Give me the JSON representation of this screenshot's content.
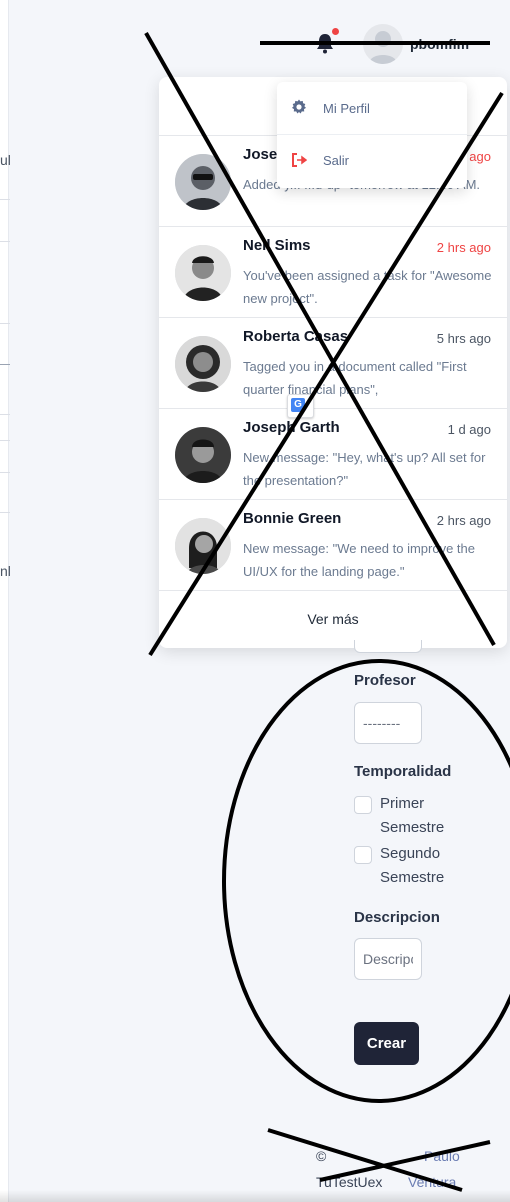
{
  "left_fragments": [
    "ul",
    "nl"
  ],
  "navbar": {
    "bell_icon": "bell-icon",
    "username": "pbomfim"
  },
  "notifications": {
    "items": [
      {
        "name": "Jose",
        "time": "ago",
        "time_color": "#ef4444",
        "message": "Added y... ...d-up\" tomorrow at 12:30 AM."
      },
      {
        "name": "Neil Sims",
        "time": "2 hrs ago",
        "time_color": "#ef4444",
        "message": "You've been assigned a task for \"Awesome new project\"."
      },
      {
        "name": "Roberta Casas",
        "time": "5 hrs ago",
        "time_color": "#4b5563",
        "message": "Tagged you in a document called \"First quarter financial plans\","
      },
      {
        "name": "Joseph Garth",
        "time": "1 d ago",
        "time_color": "#4b5563",
        "message": "New message: \"Hey, what's up? All set for the presentation?\""
      },
      {
        "name": "Bonnie Green",
        "time": "2 hrs ago",
        "time_color": "#4b5563",
        "message": "New message: \"We need to improve the UI/UX for the landing page.\""
      }
    ],
    "footer_label": "Ver más"
  },
  "profile_menu": {
    "items": [
      {
        "label": "Mi Perfil",
        "icon": "gear-icon"
      },
      {
        "label": "Salir",
        "icon": "logout-icon"
      }
    ]
  },
  "translate_badge": {
    "letter": "G"
  },
  "form": {
    "profesor_label": "Profesor",
    "profesor_placeholder": "--------",
    "temporalidad_label": "Temporalidad",
    "options": [
      {
        "label": "Primer Semestre",
        "checked": false
      },
      {
        "label": "Segundo Semestre",
        "checked": false
      }
    ],
    "descripcion_label": "Descripcion",
    "descripcion_placeholder": "Descripcion",
    "submit_label": "Crear"
  },
  "footer": {
    "copyright": "©",
    "brand": "TuTestUex",
    "author_first": "Paulo",
    "author_last": "Ventura"
  },
  "colors": {
    "accent": "#1f2437",
    "danger": "#ef4444",
    "link": "#6b7db3"
  }
}
